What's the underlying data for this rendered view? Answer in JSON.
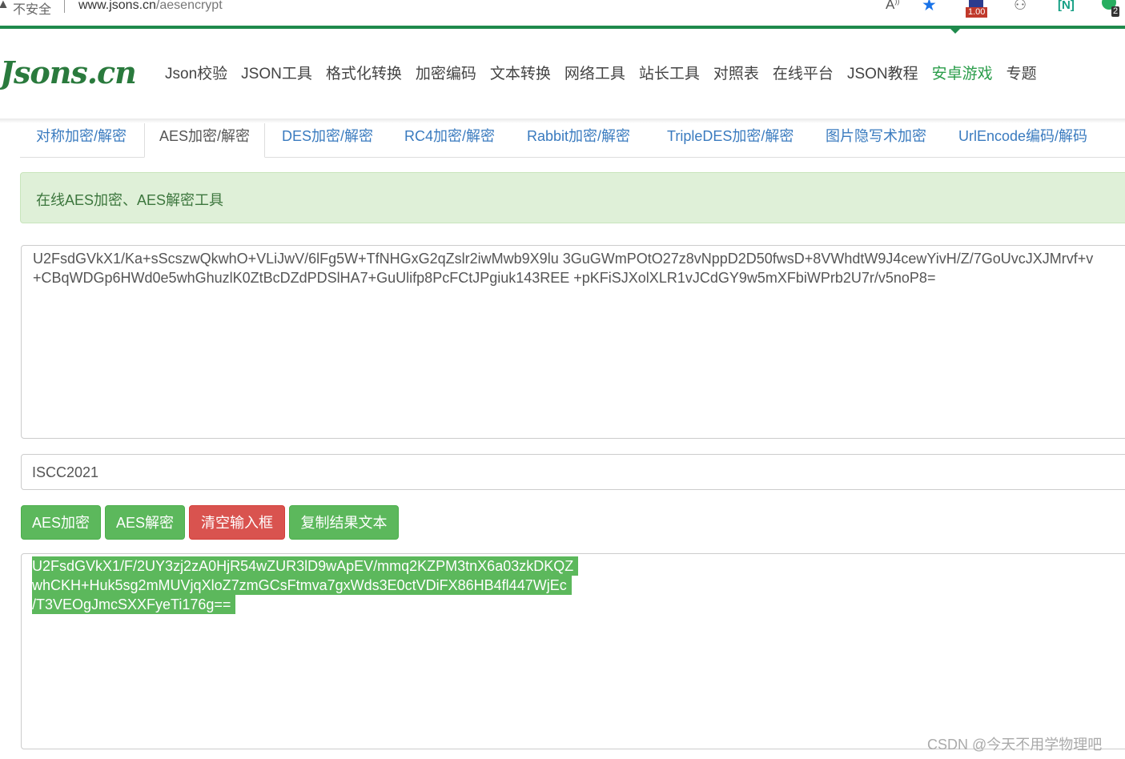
{
  "browser": {
    "insecure_label": "不安全",
    "url_host": "www.jsons.cn",
    "url_path": "/aesencrypt",
    "ext_badge_value": "1.00",
    "ext_shield_count": "2"
  },
  "site": {
    "logo": "Jsons.cn",
    "nav": [
      "Json校验",
      "JSON工具",
      "格式化转换",
      "加密编码",
      "文本转换",
      "网络工具",
      "站长工具",
      "对照表",
      "在线平台",
      "JSON教程",
      "安卓游戏",
      "专题"
    ],
    "nav_active_index": 10
  },
  "tabs": [
    "对称加密/解密",
    "AES加密/解密",
    "DES加密/解密",
    "RC4加密/解密",
    "Rabbit加密/解密",
    "TripleDES加密/解密",
    "图片隐写术加密",
    "UrlEncode编码/解码"
  ],
  "active_tab": "AES加密/解密",
  "alert_text": "在线AES加密、AES解密工具",
  "input_text": {
    "line1": "U2FsdGVkX1/Ka+sScszwQkwhO+VLiJwV/6lFg5W+TfNHGxG2qZslr2iwMwb9X9lu 3GuGWmPOtO27z8vNppD2D50fwsD+8VWhdtW9J4cewYivH/Z/7GoUvcJXJMrvf+v",
    "line2": "+CBqWDGp6HWd0e5whGhuzlK0ZtBcDZdPDSlHA7+GuUlifp8PcFCtJPgiuk143REE +pKFiSJXolXLR1vJCdGY9w5mXFbiWPrb2U7r/v5noP8="
  },
  "key_value": "ISCC2021",
  "buttons": {
    "aes_encrypt": "AES加密",
    "aes_decrypt": "AES解密",
    "clear": "清空输入框",
    "copy": "复制结果文本"
  },
  "output_text": {
    "line1": "U2FsdGVkX1/F/2UY3zj2zA0HjR54wZUR3lD9wApEV/mmq2KZPM3tnX6a03zkDKQZ",
    "line2": "whCKH+Huk5sg2mMUVjqXloZ7zmGCsFtmva7gxWds3E0ctVDiFX86HB4fl447WjEc",
    "line3": "/T3VEOgJmcSXXFyeTi176g=="
  },
  "watermark": "CSDN @今天不用学物理吧",
  "colors": {
    "brand_green": "#2a7a3d",
    "button_green": "#5cb85c",
    "button_red": "#d9534f",
    "alert_bg": "#dff0d8",
    "tab_link": "#3a7bbf"
  }
}
